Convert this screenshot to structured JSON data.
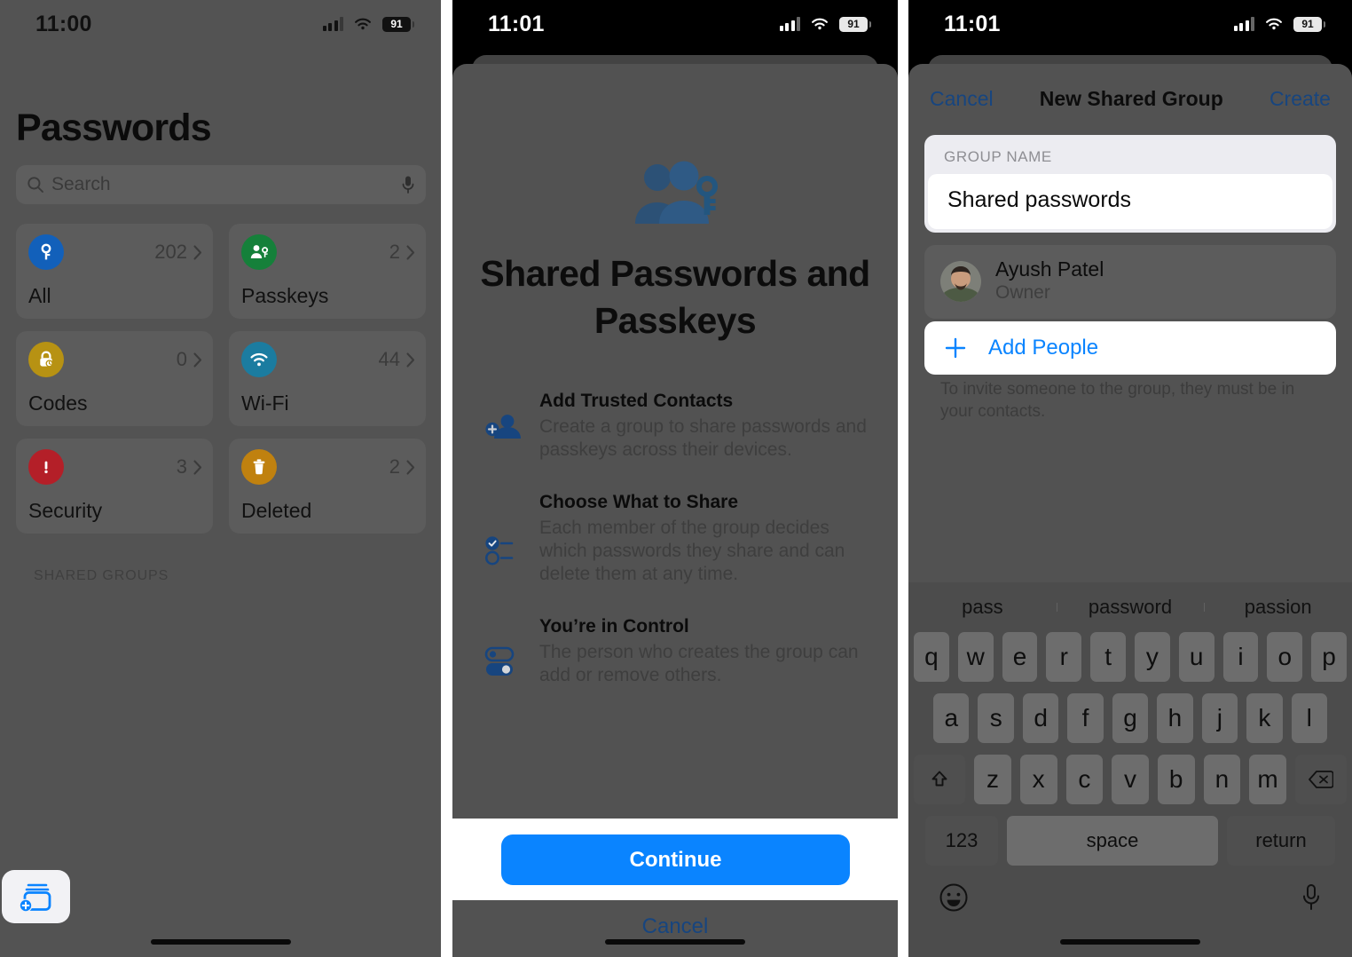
{
  "panel1": {
    "status": {
      "time": "11:00",
      "battery": "91",
      "signal_icon": "cellular-bars-icon",
      "wifi_icon": "wifi-icon",
      "battery_icon": "battery-icon"
    },
    "title": "Passwords",
    "search": {
      "placeholder": "Search",
      "icon": "search-icon",
      "mic_icon": "microphone-icon"
    },
    "categories": [
      {
        "label": "All",
        "count": "202",
        "icon": "key-icon",
        "color": "#1260ba"
      },
      {
        "label": "Passkeys",
        "count": "2",
        "icon": "person-key-icon",
        "color": "#15803a"
      },
      {
        "label": "Codes",
        "count": "0",
        "icon": "lock-clock-icon",
        "color": "#b79213"
      },
      {
        "label": "Wi-Fi",
        "count": "44",
        "icon": "wifi-icon",
        "color": "#1b7ca0"
      },
      {
        "label": "Security",
        "count": "3",
        "icon": "warning-icon",
        "color": "#b41f28"
      },
      {
        "label": "Deleted",
        "count": "2",
        "icon": "trash-icon",
        "color": "#c0810f"
      }
    ],
    "shared_groups_header": "SHARED GROUPS",
    "new_group_button": {
      "icon": "new-shared-group-icon"
    }
  },
  "panel2": {
    "status": {
      "time": "11:01",
      "battery": "91"
    },
    "hero_icon": "two-people-key-icon",
    "title": "Shared Passwords and Passkeys",
    "features": [
      {
        "icon": "person-plus-icon",
        "heading": "Add Trusted Contacts",
        "body": "Create a group to share passwords and passkeys across their devices."
      },
      {
        "icon": "checklist-icon",
        "heading": "Choose What to Share",
        "body": "Each member of the group decides which passwords they share and can delete them at any time."
      },
      {
        "icon": "toggles-icon",
        "heading": "You’re in Control",
        "body": "The person who creates the group can add or remove others."
      }
    ],
    "continue_label": "Continue",
    "cancel_label": "Cancel"
  },
  "panel3": {
    "status": {
      "time": "11:01",
      "battery": "91"
    },
    "nav": {
      "cancel": "Cancel",
      "title": "New Shared Group",
      "create": "Create"
    },
    "group_name": {
      "label": "GROUP NAME",
      "value": "Shared passwords"
    },
    "member": {
      "name": "Ayush Patel",
      "role": "Owner",
      "avatar": "user-avatar"
    },
    "add_people": {
      "label": "Add People",
      "icon": "plus-icon"
    },
    "hint": "To invite someone to the group, they must be in your contacts.",
    "keyboard": {
      "predictions": [
        "pass",
        "password",
        "passion"
      ],
      "row1": [
        "q",
        "w",
        "e",
        "r",
        "t",
        "y",
        "u",
        "i",
        "o",
        "p"
      ],
      "row2": [
        "a",
        "s",
        "d",
        "f",
        "g",
        "h",
        "j",
        "k",
        "l"
      ],
      "row3": [
        "z",
        "x",
        "c",
        "v",
        "b",
        "n",
        "m"
      ],
      "shift_icon": "shift-icon",
      "backspace_icon": "backspace-icon",
      "numbers_label": "123",
      "space_label": "space",
      "return_label": "return",
      "emoji_icon": "emoji-icon",
      "dictation_icon": "microphone-icon"
    }
  },
  "colors": {
    "accent_blue": "#0a84ff",
    "link_blue": "#17457f"
  }
}
